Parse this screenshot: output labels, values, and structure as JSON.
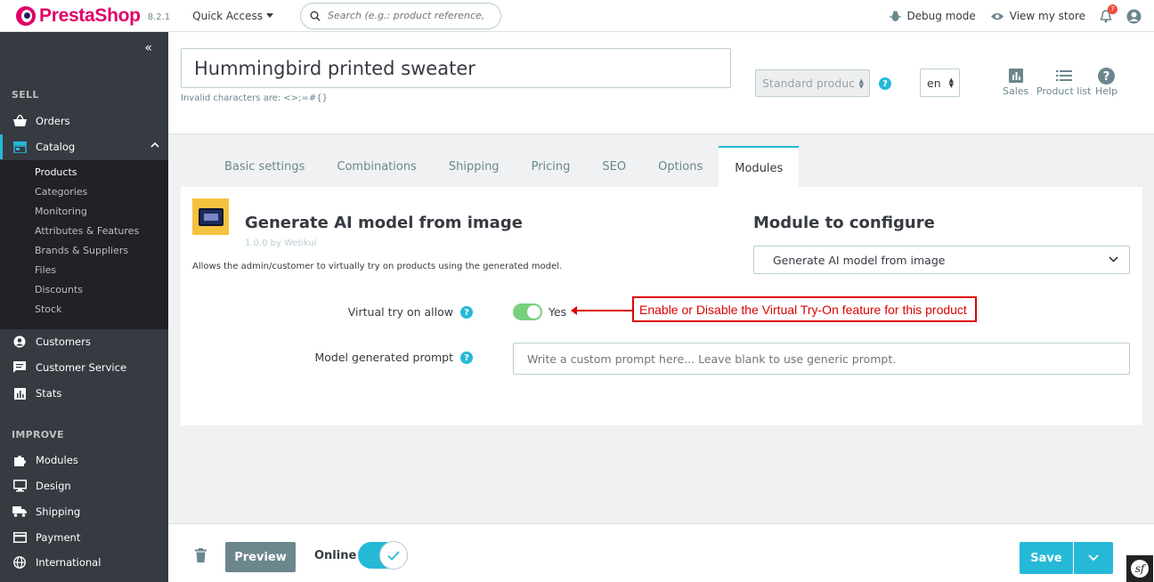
{
  "header": {
    "brand": "PrestaShop",
    "version": "8.2.1",
    "quick_access": "Quick Access",
    "search_placeholder": "Search (e.g.: product reference, custon",
    "debug_mode": "Debug mode",
    "view_store": "View my store",
    "notification_count": "7"
  },
  "sidebar": {
    "sell_title": "SELL",
    "improve_title": "IMPROVE",
    "items": [
      {
        "label": "Orders",
        "icon": "basket-icon"
      },
      {
        "label": "Catalog",
        "icon": "store-icon"
      },
      {
        "label": "Customers",
        "icon": "account-icon"
      },
      {
        "label": "Customer Service",
        "icon": "chat-icon"
      },
      {
        "label": "Stats",
        "icon": "stats-icon"
      },
      {
        "label": "Modules",
        "icon": "puzzle-icon"
      },
      {
        "label": "Design",
        "icon": "desktop-icon"
      },
      {
        "label": "Shipping",
        "icon": "truck-icon"
      },
      {
        "label": "Payment",
        "icon": "payment-icon"
      },
      {
        "label": "International",
        "icon": "globe-icon"
      }
    ],
    "catalog_sub": [
      "Products",
      "Categories",
      "Monitoring",
      "Attributes & Features",
      "Brands & Suppliers",
      "Files",
      "Discounts",
      "Stock"
    ]
  },
  "product": {
    "name": "Hummingbird printed sweater",
    "invalid_chars": "Invalid characters are: <>;=#{}",
    "type": "Standard produc",
    "lang": "en",
    "actions": {
      "sales": "Sales",
      "product_list": "Product list",
      "help": "Help"
    }
  },
  "tabs": [
    "Basic settings",
    "Combinations",
    "Shipping",
    "Pricing",
    "SEO",
    "Options",
    "Modules"
  ],
  "module": {
    "title": "Generate AI model from image",
    "version": "1.0.0 by Webkul",
    "description": "Allows the admin/customer to virtually try on products using the generated model.",
    "configure_title": "Module to configure",
    "configure_selected": "Generate AI model from image",
    "tryon_label": "Virtual try on allow",
    "tryon_value": "Yes",
    "tryon_enabled": true,
    "prompt_label": "Model generated prompt",
    "prompt_placeholder": "Write a custom prompt here... Leave blank to use generic prompt.",
    "annotation": "Enable or Disable the Virtual Try-On feature for this product"
  },
  "footer": {
    "preview": "Preview",
    "online": "Online",
    "save": "Save"
  },
  "colors": {
    "accent": "#25b9d7",
    "sidebar": "#363a41",
    "brand": "#df0067",
    "toggle_on": "#78d07d",
    "annotation": "#dd0000"
  }
}
